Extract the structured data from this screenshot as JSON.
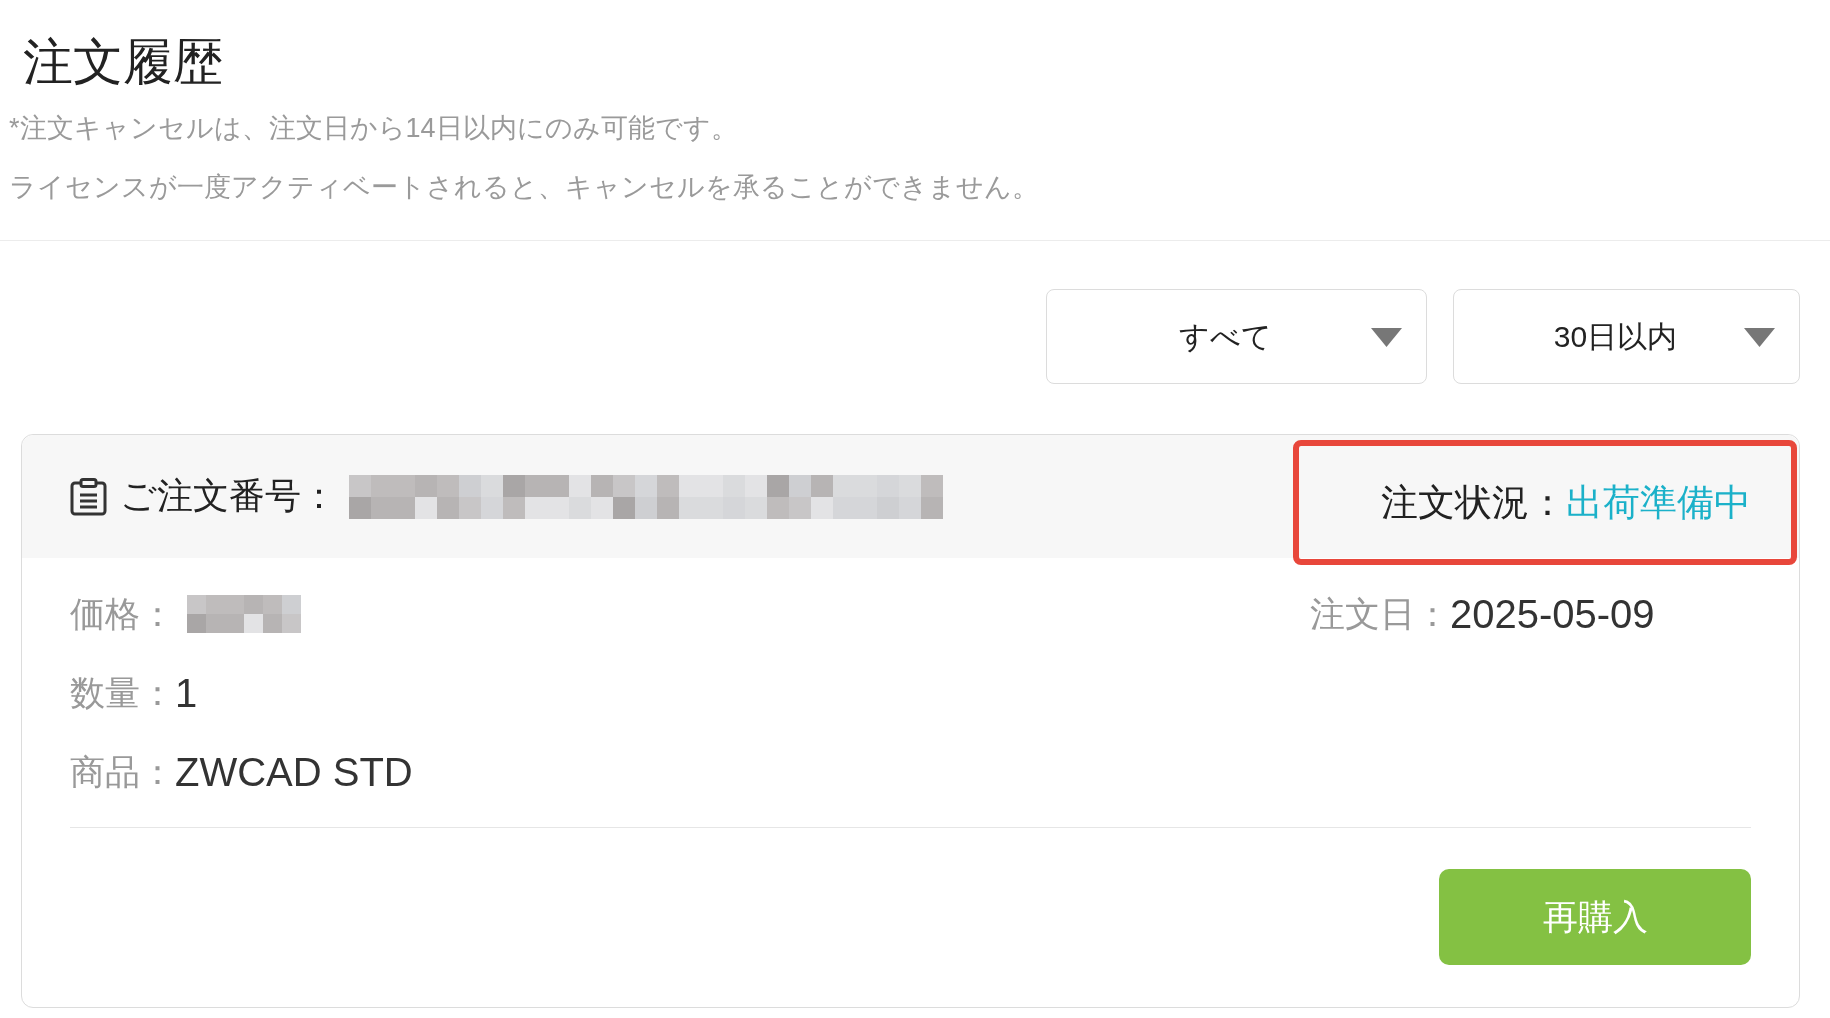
{
  "page": {
    "title": "注文履歴",
    "notes": [
      "*注文キャンセルは、注文日から14日以内にのみ可能です。",
      "ライセンスが一度アクティベートされると、キャンセルを承ることができません。"
    ]
  },
  "filters": [
    {
      "value": "すべて"
    },
    {
      "value": "30日以内"
    }
  ],
  "order": {
    "number": {
      "label": "ご注文番号：",
      "redacted": true
    },
    "status": {
      "label": "注文状況：",
      "value": "出荷準備中",
      "highlighted": true
    },
    "details": [
      {
        "kind": "redacted",
        "label": "価格："
      },
      {
        "kind": "text",
        "label": "数量：",
        "value": "1"
      },
      {
        "kind": "text",
        "label": "商品：",
        "value": "ZWCAD STD"
      }
    ],
    "date": {
      "label": "注文日：",
      "value": "2025-05-09"
    },
    "action": "再購入"
  }
}
